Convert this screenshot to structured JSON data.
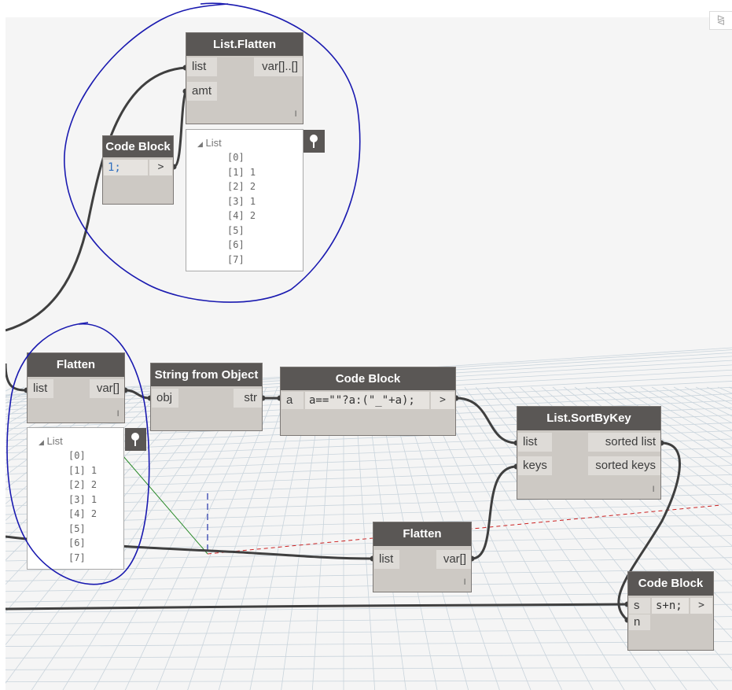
{
  "nodes": {
    "list_flatten_top": {
      "title": "List.Flatten",
      "inputs": [
        "list",
        "amt"
      ],
      "output": "var[]..[]",
      "lacing": "l"
    },
    "code_block_one": {
      "title": "Code Block",
      "code": "1;",
      "output": ">"
    },
    "flatten_left": {
      "title": "Flatten",
      "input": "list",
      "output": "var[]",
      "lacing": "l"
    },
    "string_from_object": {
      "title": "String from Object",
      "input": "obj",
      "output": "str"
    },
    "code_block_mid": {
      "title": "Code Block",
      "input": "a",
      "code": "a==\"\"?a:(\"_\"+a);",
      "output": ">"
    },
    "list_sort_by_key": {
      "title": "List.SortByKey",
      "inputs": [
        "list",
        "keys"
      ],
      "outputs": [
        "sorted list",
        "sorted keys"
      ],
      "lacing": "l"
    },
    "flatten_bottom": {
      "title": "Flatten",
      "input": "list",
      "output": "var[]",
      "lacing": "l"
    },
    "code_block_bottom": {
      "title": "Code Block",
      "inputs": [
        "s",
        "n"
      ],
      "code": "s+n;",
      "output": ">"
    }
  },
  "previews": {
    "top": {
      "header": "List",
      "items": [
        "[0]",
        "[1] 1",
        "[2] 2",
        "[3] 1",
        "[4] 2",
        "[5]",
        "[6]",
        "[7]"
      ]
    },
    "left": {
      "header": "List",
      "items": [
        "[0]",
        "[1] 1",
        "[2] 2",
        "[3] 1",
        "[4] 2",
        "[5]",
        "[6]",
        "[7]"
      ]
    }
  },
  "icons": {
    "pin": "pin-icon",
    "collapse": "triangle-collapse-icon",
    "corner": "toggle-view-icon"
  },
  "colors": {
    "canvas": "#f5f5f5",
    "node_header": "#5a5755",
    "node_body": "#cdc9c4",
    "wire": "#3f3f3f",
    "annotation_ink": "#1a1ab0",
    "grid_axis_red": "#cc2222",
    "grid_axis_green": "#2a8a2a",
    "grid_axis_blue": "#2233aa"
  }
}
